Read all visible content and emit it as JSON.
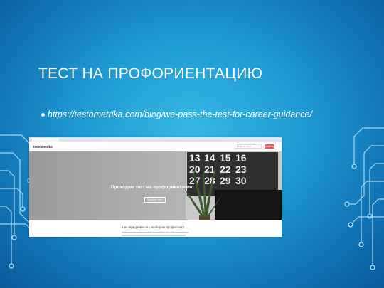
{
  "slide": {
    "title": "ТЕСТ НА ПРОФОРИЕНТАЦИЮ",
    "bullet_link": "https://testometrika.com/blog/we-pass-the-test-for-career-guidance/"
  },
  "screenshot": {
    "site_logo": "testometrika",
    "nav_search_placeholder": "Найти тест",
    "nav_button": "Войти",
    "hero_title": "Проходим тест на профориентацию",
    "hero_button": "Пройти тест",
    "calendar_numbers": [
      "13",
      "14",
      "15",
      "16",
      "20",
      "21",
      "22",
      "23",
      "27",
      "28",
      "29",
      "30"
    ],
    "article_title": "Как определиться с выбором профессии?"
  },
  "colors": {
    "background_center": "#34b8e3",
    "background_edge": "#0a5a9a",
    "circuit_lines": "#bfe8f7",
    "text": "#ffffff",
    "nav_button": "#e85a5a"
  }
}
